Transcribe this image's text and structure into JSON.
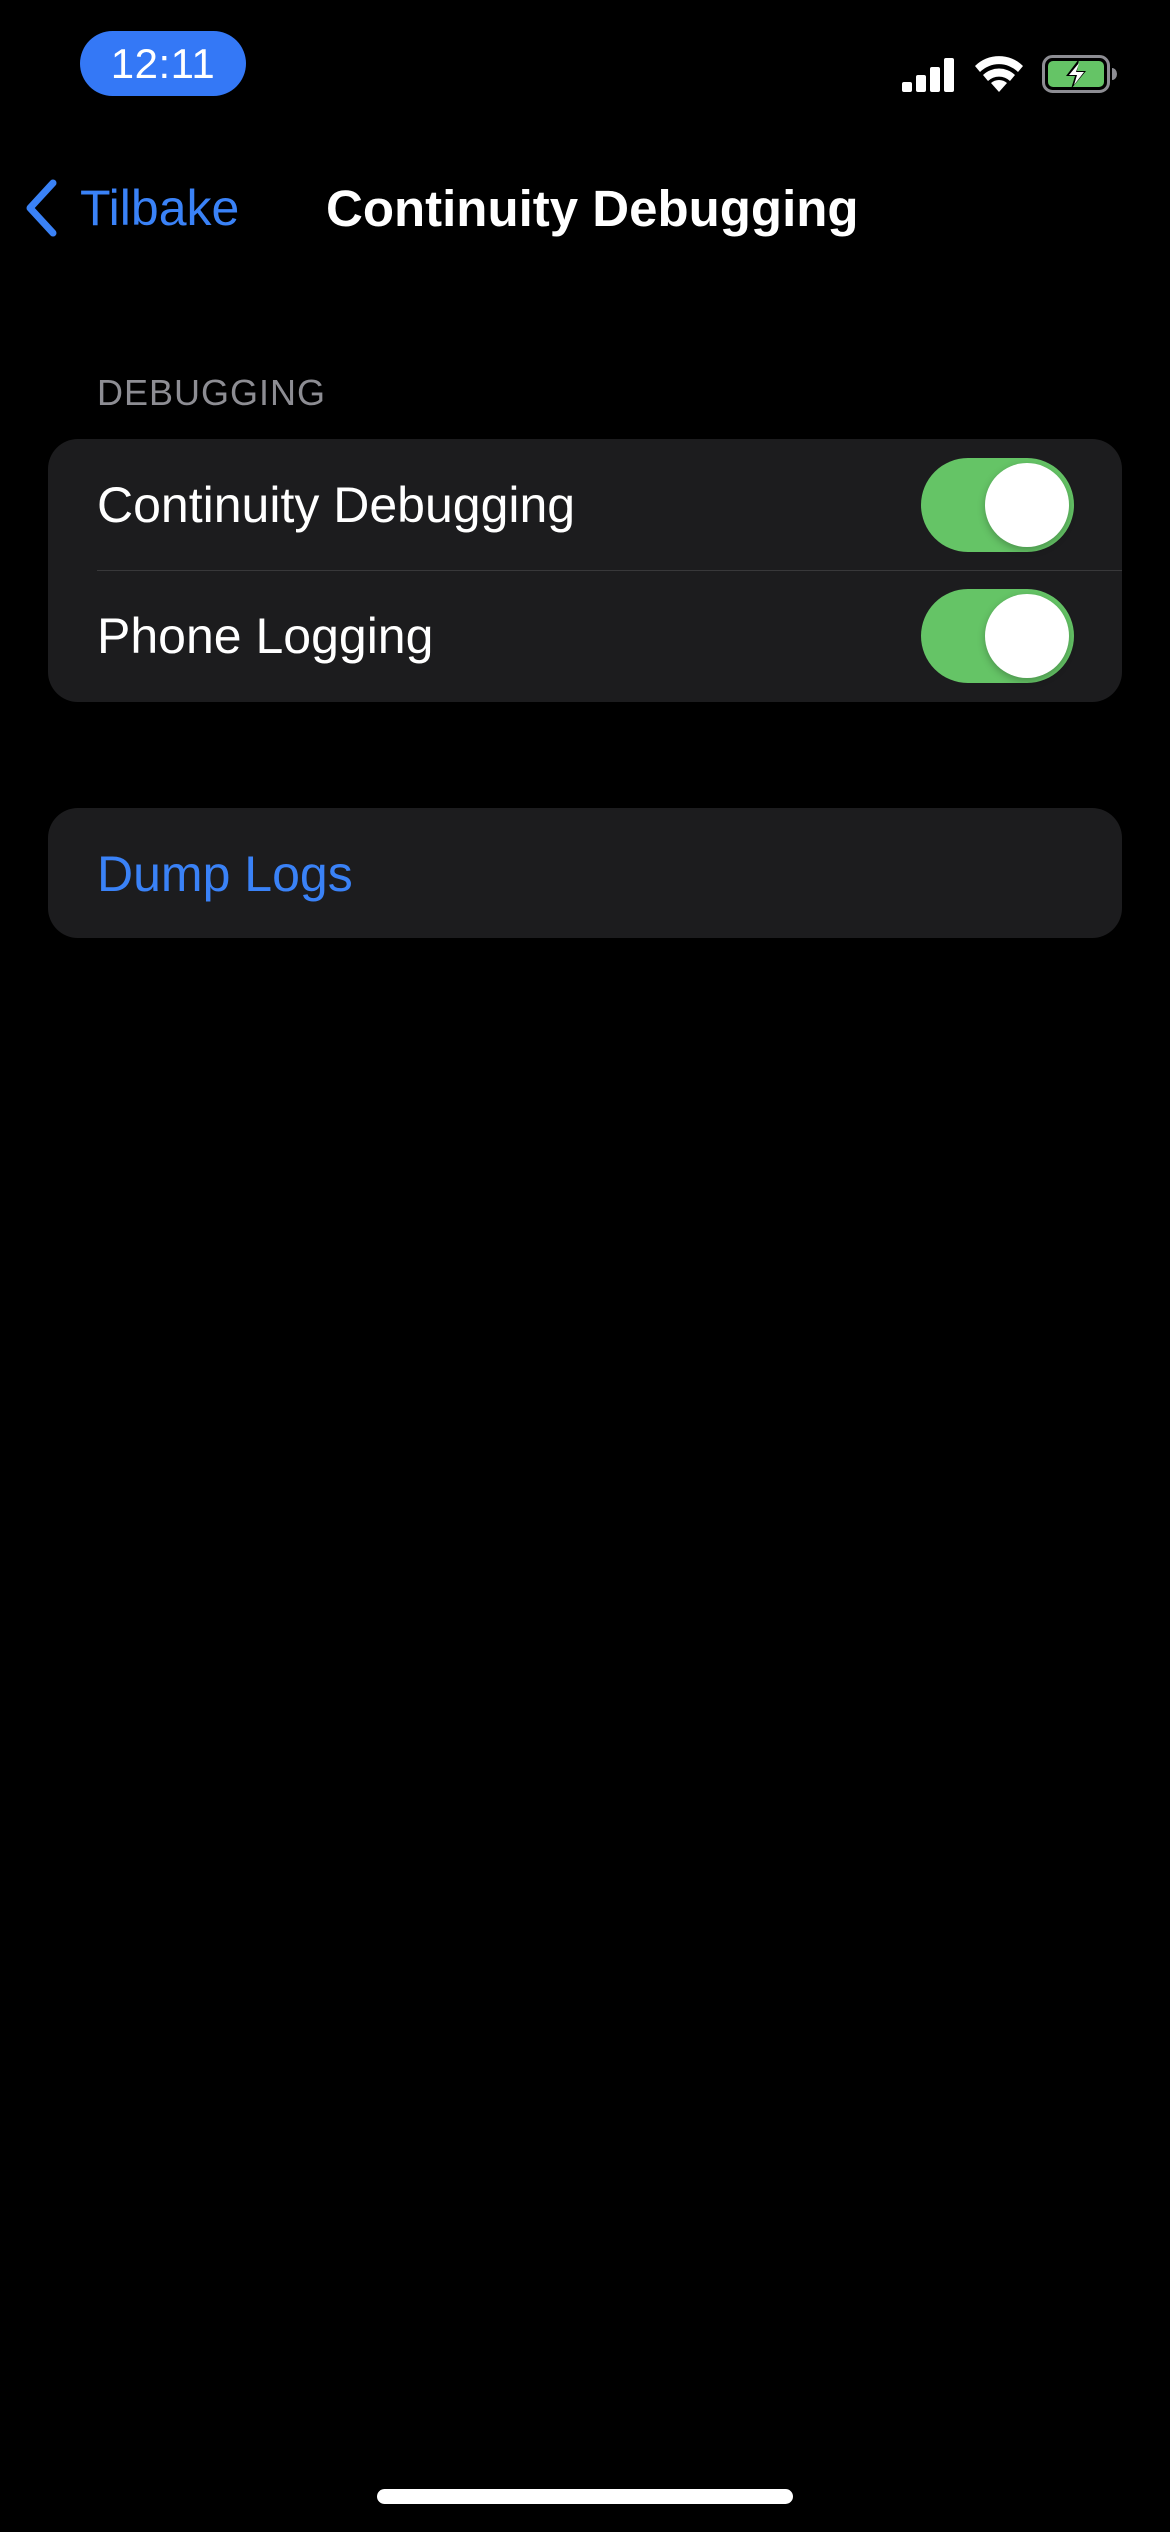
{
  "status_bar": {
    "time": "12:11",
    "icons": [
      "cellular-signal-icon",
      "wifi-icon",
      "battery-charging-icon"
    ]
  },
  "nav": {
    "back_label": "Tilbake",
    "title": "Continuity Debugging"
  },
  "sections": {
    "debugging": {
      "header": "DEBUGGING",
      "rows": [
        {
          "label": "Continuity Debugging",
          "toggle_on": true
        },
        {
          "label": "Phone Logging",
          "toggle_on": true
        }
      ]
    },
    "actions": {
      "rows": [
        {
          "label": "Dump Logs"
        }
      ]
    }
  },
  "colors": {
    "accent": "#3a82f7",
    "time_pill": "#3478f6",
    "toggle_on": "#65c466",
    "battery_charging": "#65c466",
    "group_background": "#1c1c1e",
    "section_header": "#8d8d93",
    "background": "#000000"
  }
}
